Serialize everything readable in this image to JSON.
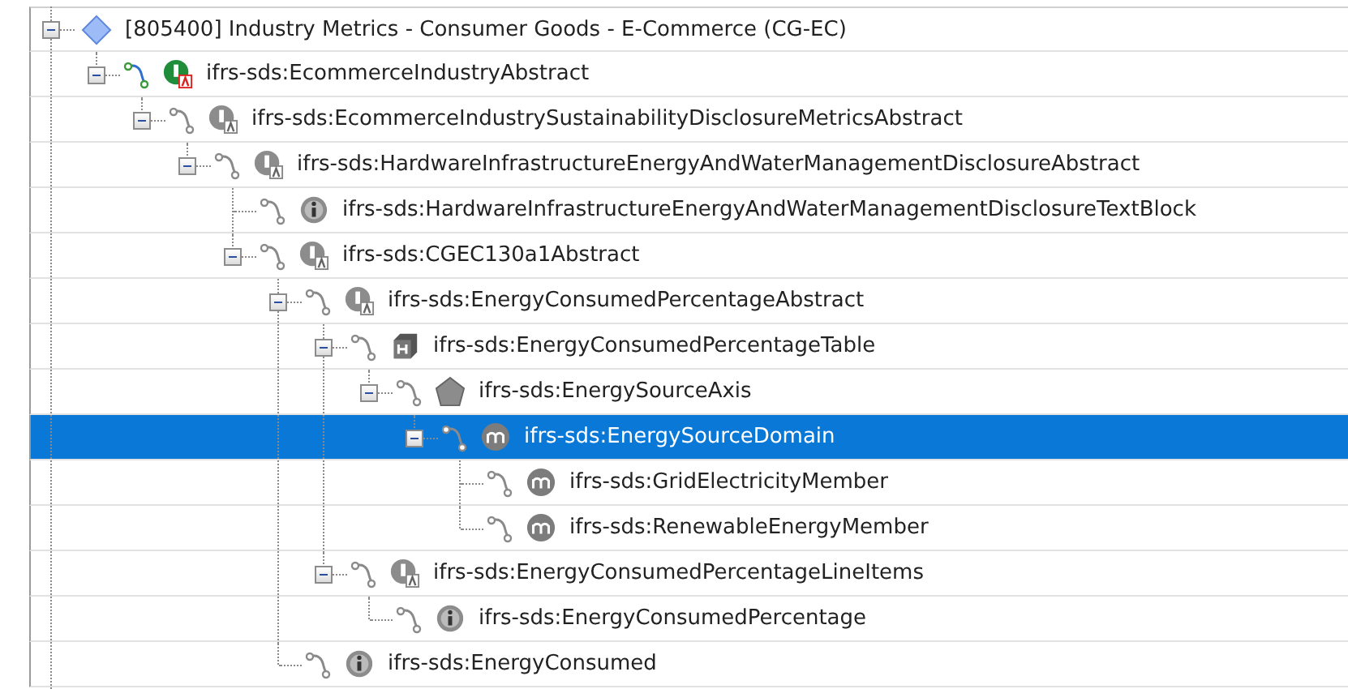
{
  "tree": [
    {
      "label": "[805400] Industry Metrics - Consumer Goods - E-Commerce (CG-EC)",
      "kind": "network",
      "expanded": true,
      "selected": false,
      "children": [
        {
          "label": "ifrs-sds:EcommerceIndustryAbstract",
          "kind": "root-abstract",
          "expanded": true,
          "selected": false,
          "children": [
            {
              "label": "ifrs-sds:EcommerceIndustrySustainabilityDisclosureMetricsAbstract",
              "kind": "abstract",
              "expanded": true,
              "selected": false,
              "children": [
                {
                  "label": "ifrs-sds:HardwareInfrastructureEnergyAndWaterManagementDisclosureAbstract",
                  "kind": "abstract",
                  "expanded": true,
                  "selected": false,
                  "children": [
                    {
                      "label": "ifrs-sds:HardwareInfrastructureEnergyAndWaterManagementDisclosureTextBlock",
                      "kind": "item",
                      "selected": false
                    },
                    {
                      "label": "ifrs-sds:CGEC130a1Abstract",
                      "kind": "abstract",
                      "expanded": true,
                      "selected": false,
                      "children": [
                        {
                          "label": "ifrs-sds:EnergyConsumedPercentageAbstract",
                          "kind": "abstract",
                          "expanded": true,
                          "selected": false,
                          "children": [
                            {
                              "label": "ifrs-sds:EnergyConsumedPercentageTable",
                              "kind": "hypercube",
                              "expanded": true,
                              "selected": false,
                              "children": [
                                {
                                  "label": "ifrs-sds:EnergySourceAxis",
                                  "kind": "dimension",
                                  "expanded": true,
                                  "selected": false,
                                  "children": [
                                    {
                                      "label": "ifrs-sds:EnergySourceDomain",
                                      "kind": "member",
                                      "expanded": true,
                                      "selected": true,
                                      "children": [
                                        {
                                          "label": "ifrs-sds:GridElectricityMember",
                                          "kind": "member",
                                          "selected": false
                                        },
                                        {
                                          "label": "ifrs-sds:RenewableEnergyMember",
                                          "kind": "member",
                                          "selected": false
                                        }
                                      ]
                                    }
                                  ]
                                }
                              ]
                            },
                            {
                              "label": "ifrs-sds:EnergyConsumedPercentageLineItems",
                              "kind": "abstract",
                              "expanded": true,
                              "selected": false,
                              "children": [
                                {
                                  "label": "ifrs-sds:EnergyConsumedPercentage",
                                  "kind": "item",
                                  "selected": false
                                }
                              ]
                            }
                          ]
                        },
                        {
                          "label": "ifrs-sds:EnergyConsumed",
                          "kind": "item",
                          "selected": false
                        }
                      ]
                    }
                  ]
                }
              ]
            }
          ]
        }
      ]
    }
  ]
}
